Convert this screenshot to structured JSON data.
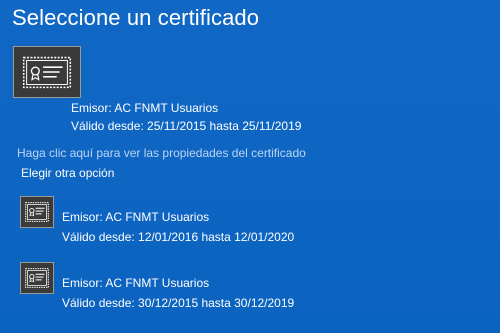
{
  "dialog": {
    "title": "Seleccione un certificado"
  },
  "selected_certificate": {
    "icon": "certificate-icon",
    "issuer": "Emisor: AC FNMT Usuarios",
    "validity": "Válido desde: 25/11/2015 hasta 25/11/2019"
  },
  "properties_link": "Haga clic aquí para ver las propiedades del certificado",
  "other_option_label": "Elegir otra opción",
  "other_certificates": [
    {
      "icon": "certificate-icon",
      "issuer": "Emisor: AC FNMT Usuarios",
      "validity": "Válido desde: 12/01/2016 hasta 12/01/2020"
    },
    {
      "icon": "certificate-icon",
      "issuer": "Emisor: AC FNMT Usuarios",
      "validity": "Válido desde: 30/12/2015 hasta 30/12/2019"
    }
  ],
  "colors": {
    "background": "#0b63c0",
    "link": "#bcd6f5",
    "icon_tile": "#3a3a3a"
  }
}
